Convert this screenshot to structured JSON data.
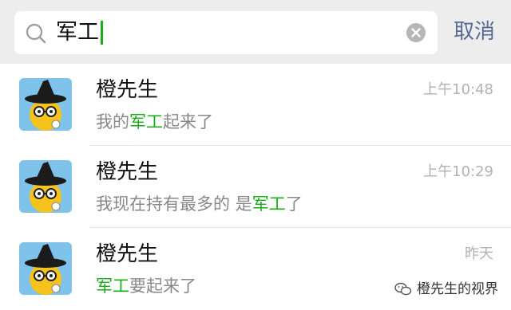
{
  "search": {
    "query": "军工",
    "cancel_label": "取消"
  },
  "colors": {
    "highlight": "#1aad19",
    "link": "#576b95"
  },
  "results": [
    {
      "name": "橙先生",
      "time": "上午10:48",
      "message_before": "我的",
      "message_highlight": "军工",
      "message_after": "起来了"
    },
    {
      "name": "橙先生",
      "time": "上午10:29",
      "message_before": "我现在持有最多的 是",
      "message_highlight": "军工",
      "message_after": "了"
    },
    {
      "name": "橙先生",
      "time": "昨天",
      "message_before": "",
      "message_highlight": "军工",
      "message_after": "要起来了"
    }
  ],
  "watermark": {
    "text": "橙先生的视界",
    "icon": "wechat-icon"
  }
}
